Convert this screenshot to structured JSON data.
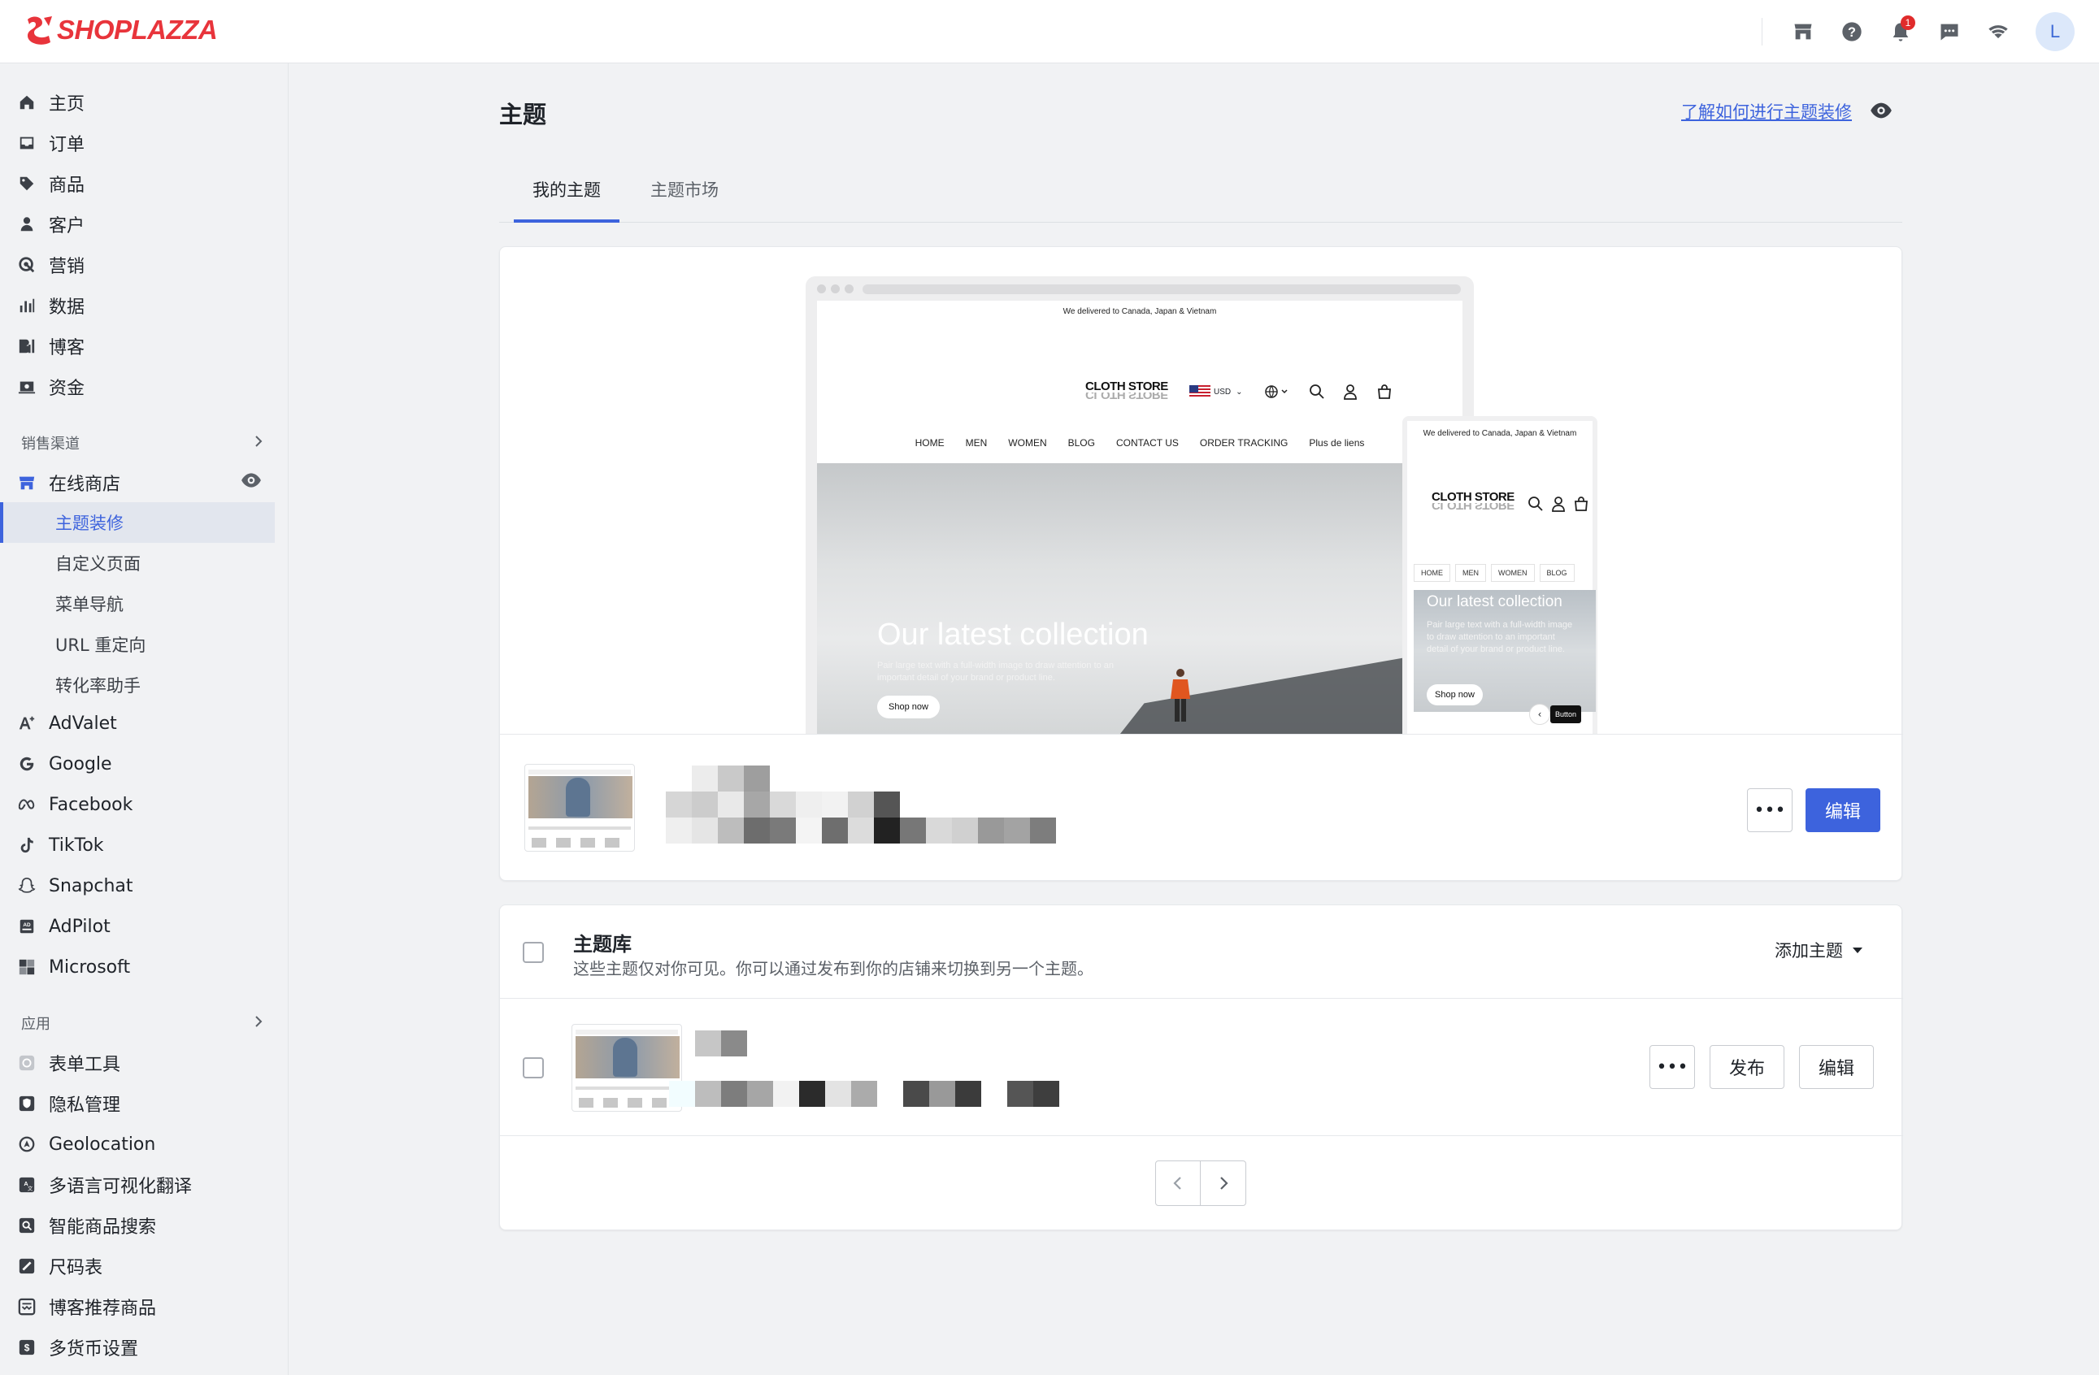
{
  "app": {
    "brand": "SHOPLAZZA",
    "avatar_initial": "L",
    "notification_count": "1",
    "colors": {
      "brand_red": "#e8343b",
      "accent_blue": "#3d63dd"
    }
  },
  "sidebar": {
    "main_items": [
      {
        "label": "主页",
        "icon": "home-icon"
      },
      {
        "label": "订单",
        "icon": "inbox-icon"
      },
      {
        "label": "商品",
        "icon": "tag-icon"
      },
      {
        "label": "客户",
        "icon": "person-icon"
      },
      {
        "label": "营销",
        "icon": "target-icon"
      },
      {
        "label": "数据",
        "icon": "bar-chart-icon"
      },
      {
        "label": "博客",
        "icon": "blog-icon"
      },
      {
        "label": "资金",
        "icon": "wallet-icon"
      }
    ],
    "sales_channels_title": "销售渠道",
    "online_store": "在线商店",
    "online_store_sub": [
      "主题装修",
      "自定义页面",
      "菜单导航",
      "URL 重定向",
      "转化率助手"
    ],
    "channels": [
      "AdValet",
      "Google",
      "Facebook",
      "TikTok",
      "Snapchat",
      "AdPilot",
      "Microsoft"
    ],
    "apps_title": "应用",
    "apps": [
      "表单工具",
      "隐私管理",
      "Geolocation",
      "多语言可视化翻译",
      "智能商品搜索",
      "尺码表",
      "博客推荐商品",
      "多货币设置"
    ]
  },
  "main": {
    "title": "主题",
    "learn_link": "了解如何进行主题装修",
    "tabs": [
      "我的主题",
      "主题市场"
    ],
    "preview": {
      "announcement": "We delivered to Canada, Japan & Vietnam",
      "store_name": "CLOTH STORE",
      "currency": "USD",
      "nav": [
        "HOME",
        "MEN",
        "WOMEN",
        "BLOG",
        "CONTACT US",
        "ORDER TRACKING",
        "Plus de liens"
      ],
      "mobile_nav": [
        "HOME",
        "MEN",
        "WOMEN",
        "BLOG"
      ],
      "hero_title": "Our latest collection",
      "hero_sub": "Pair large text with a full-width image to draw attention to an important detail of your brand or product line.",
      "shop_now": "Shop now",
      "mobile_button": "Button"
    },
    "current_theme": {
      "more_label": "•••",
      "edit_label": "编辑"
    },
    "library": {
      "title": "主题库",
      "description": "这些主题仅对你可见。你可以通过发布到你的店铺来切换到另一个主题。",
      "add_theme": "添加主题",
      "more_label": "•••",
      "publish_label": "发布",
      "edit_label": "编辑"
    }
  }
}
